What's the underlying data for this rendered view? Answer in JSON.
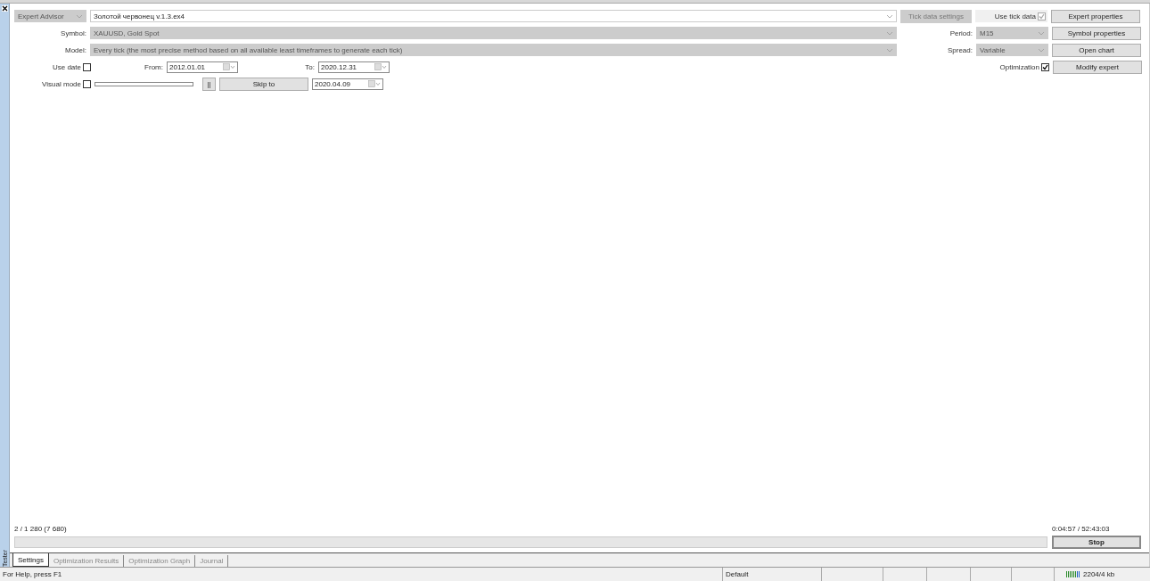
{
  "side_panel": {
    "title": "Tester"
  },
  "settings": {
    "type_combo": {
      "value": "Expert Advisor",
      "disabled": true
    },
    "expert_combo": {
      "value": "Золотой червонец v.1.3.ex4",
      "disabled": false
    },
    "tick_data_button": {
      "label": "Tick data settings",
      "disabled": true
    },
    "use_tick_data": {
      "label": "Use tick data",
      "checked": true,
      "disabled": true
    },
    "symbol": {
      "label": "Symbol:",
      "value": "XAUUSD, Gold Spot",
      "disabled": true
    },
    "model": {
      "label": "Model:",
      "value": "Every tick (the most precise method based on all available least timeframes to generate each tick)",
      "disabled": true
    },
    "period": {
      "label": "Period:",
      "value": "M15",
      "disabled": true
    },
    "spread": {
      "label": "Spread:",
      "value": "Variable",
      "disabled": true
    },
    "use_date": {
      "label": "Use date",
      "checked": false
    },
    "from": {
      "label": "From:",
      "value": "2012.01.01"
    },
    "to": {
      "label": "To:",
      "value": "2020.12.31"
    },
    "visual_mode": {
      "label": "Visual mode",
      "checked": false
    },
    "pause_button": {
      "label": "||"
    },
    "skip_button": {
      "label": "Skip to"
    },
    "skip_date": {
      "value": "2020.04.09"
    },
    "optimization": {
      "label": "Optimization",
      "checked": true
    },
    "right_buttons": [
      "Expert properties",
      "Symbol properties",
      "Open chart",
      "Modify expert"
    ]
  },
  "progress": {
    "passes": "2 / 1 280 (7 680)",
    "time": "0:04:57 / 52:43:03",
    "level": 0,
    "stop_button": "Stop"
  },
  "tabs": [
    {
      "label": "Settings",
      "selected": true
    },
    {
      "label": "Optimization Results",
      "selected": false
    },
    {
      "label": "Optimization Graph",
      "selected": false
    },
    {
      "label": "Journal",
      "selected": false
    }
  ],
  "status_bar": {
    "help": "For Help, press F1",
    "profile": "Default",
    "memory": "2204/4 kb"
  }
}
